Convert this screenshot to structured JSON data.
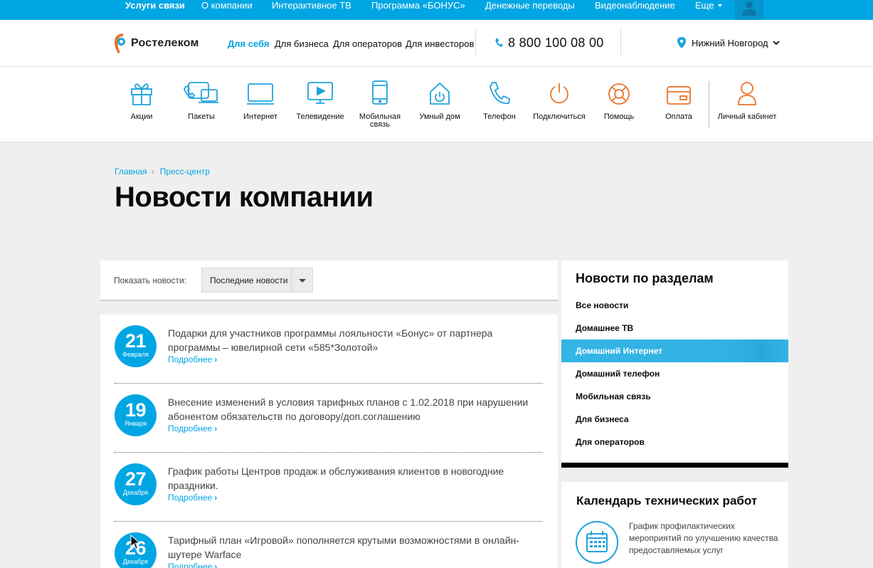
{
  "topbar": {
    "items": [
      "Услуги связи",
      "О компании",
      "Интерактивное ТВ",
      "Программа «БОНУС»",
      "Денежные переводы",
      "Видеонаблюдение",
      "Еще"
    ],
    "user_icon": "user-icon"
  },
  "header": {
    "logo_text": "Ростелеком",
    "segments": [
      "Для себя",
      "Для бизнеса",
      "Для операторов",
      "Для инвесторов"
    ],
    "phone": "8 800 100 08 00",
    "city": "Нижний Новгород"
  },
  "nav": {
    "items": [
      {
        "label": "Акции",
        "icon": "gift-icon"
      },
      {
        "label": "Пакеты",
        "icon": "packages-icon"
      },
      {
        "label": "Интернет",
        "icon": "laptop-icon"
      },
      {
        "label": "Телевидение",
        "icon": "tv-icon"
      },
      {
        "label": "Мобильная связь",
        "icon": "mobile-icon"
      },
      {
        "label": "Умный дом",
        "icon": "smart-home-icon"
      },
      {
        "label": "Телефон",
        "icon": "phone-icon"
      },
      {
        "label": "Подключиться",
        "icon": "power-icon"
      },
      {
        "label": "Помощь",
        "icon": "lifebuoy-icon"
      },
      {
        "label": "Оплата",
        "icon": "card-icon"
      },
      {
        "label": "Личный кабинет",
        "icon": "account-icon"
      }
    ]
  },
  "breadcrumbs": [
    "Главная",
    "Пресс-центр"
  ],
  "page_title": "Новости компании",
  "filter": {
    "label": "Показать новости:",
    "selected": "Последние новости"
  },
  "news": [
    {
      "day": "21",
      "month": "Февраля",
      "text": "Подарки для участников программы лояльности «Бонус» от партнера программы – ювелирной сети «585*Золотой»",
      "more": "Подробнее"
    },
    {
      "day": "19",
      "month": "Января",
      "text": "Внесение изменений в условия тарифных планов с 1.02.2018 при нарушении абонентом обязательств по договору/доп.соглашению",
      "more": "Подробнее"
    },
    {
      "day": "27",
      "month": "Декабря",
      "text": "График работы Центров продаж и обслуживания клиентов в новогодние праздники.",
      "more": "Подробнее"
    },
    {
      "day": "26",
      "month": "Декабря",
      "text": "Тарифный план «Игровой» пополняется крутыми возможностями в онлайн-шутере Warface",
      "more": "Подробнее"
    }
  ],
  "sidebar": {
    "title": "Новости по разделам",
    "items": [
      "Все новости",
      "Домашнее ТВ",
      "Домашний Интернет",
      "Домашний телефон",
      "Мобильная связь",
      "Для бизнеса",
      "Для операторов"
    ],
    "active_index": 2
  },
  "calendar": {
    "title": "Календарь технических работ",
    "text": "График профилактических мероприятий по улучшению качества предоставляемых услуг"
  },
  "colors": {
    "brand_blue": "#00a6e3",
    "icon_blue": "#1fa3dc",
    "icon_orange": "#e8752b"
  }
}
